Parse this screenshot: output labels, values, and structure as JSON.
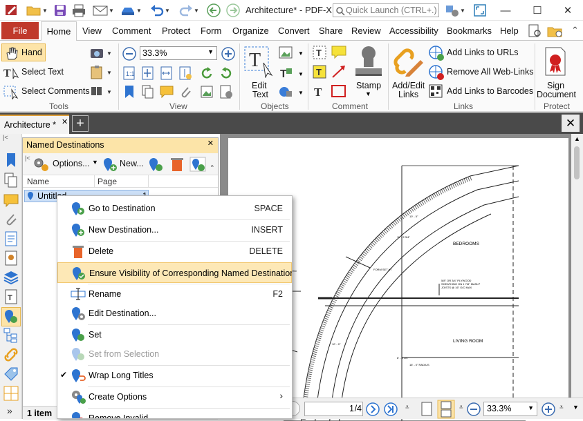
{
  "app": {
    "title": "Architecture* - PDF-X...",
    "quick_launch": "Quick Launch (CTRL+.)"
  },
  "menu": {
    "file": "File",
    "tabs": [
      "Home",
      "View",
      "Comment",
      "Protect",
      "Form",
      "Organize",
      "Convert",
      "Share",
      "Review",
      "Accessibility",
      "Bookmarks",
      "Help"
    ]
  },
  "ribbon": {
    "tools": {
      "hand": "Hand",
      "select_text": "Select Text",
      "select_comments": "Select Comments",
      "label": "Tools"
    },
    "view": {
      "zoom": "33.3%",
      "label": "View"
    },
    "objects": {
      "edit_text_1": "Edit",
      "edit_text_2": "Text",
      "label": "Objects"
    },
    "comment": {
      "stamp": "Stamp",
      "label": "Comment"
    },
    "links": {
      "add_edit_1": "Add/Edit",
      "add_edit_2": "Links",
      "add_urls": "Add Links to URLs",
      "remove_web": "Remove All Web-Links",
      "add_barcodes": "Add Links to Barcodes",
      "label": "Links"
    },
    "protect": {
      "sign_1": "Sign",
      "sign_2": "Document",
      "label": "Protect"
    }
  },
  "doc_tab": {
    "name": "Architecture *"
  },
  "panel": {
    "title": "Named Destinations",
    "options": "Options...",
    "new": "New...",
    "col_name": "Name",
    "col_page": "Page",
    "row_name": "Untitled",
    "row_page": "1",
    "status": "1 item"
  },
  "context_menu": [
    {
      "label": "Go to Destination",
      "shortcut": "SPACE"
    },
    {
      "label": "New Destination...",
      "shortcut": "INSERT"
    },
    {
      "label": "Delete",
      "shortcut": "DELETE"
    },
    {
      "label": "Ensure Visibility of Corresponding Named Destinations",
      "shortcut": ""
    },
    {
      "label": "Rename",
      "shortcut": "F2"
    },
    {
      "label": "Edit Destination...",
      "shortcut": ""
    },
    {
      "label": "Set",
      "shortcut": ""
    },
    {
      "label": "Set from Selection",
      "shortcut": ""
    },
    {
      "label": "Wrap Long Titles",
      "shortcut": ""
    },
    {
      "label": "Create Options",
      "shortcut": ""
    },
    {
      "label": "Remove Invalid",
      "shortcut": ""
    }
  ],
  "drawing": {
    "bedrooms": "BEDROOMS",
    "living_room": "LIVING ROOM",
    "form_set": "FORM SET AT",
    "plywood_1": "5/8\" OR 3/4\" PLYWOOD",
    "plywood_2": "SHEATHING ON 1 7/8\" MASLP",
    "plywood_3": "JOISTS @ 16\" O/C MAX",
    "radius": "16' - 0\" RADIUS",
    "dim_a": "11' - 2 3/4\"",
    "dim_b": "10' - 5\"",
    "dim_c": "8' - 8 1/4\"",
    "dim_d": "10' - 0\"",
    "curved": "CURVED"
  },
  "navbar": {
    "page": "1",
    "of": "/4",
    "zoom": "33.3%"
  }
}
